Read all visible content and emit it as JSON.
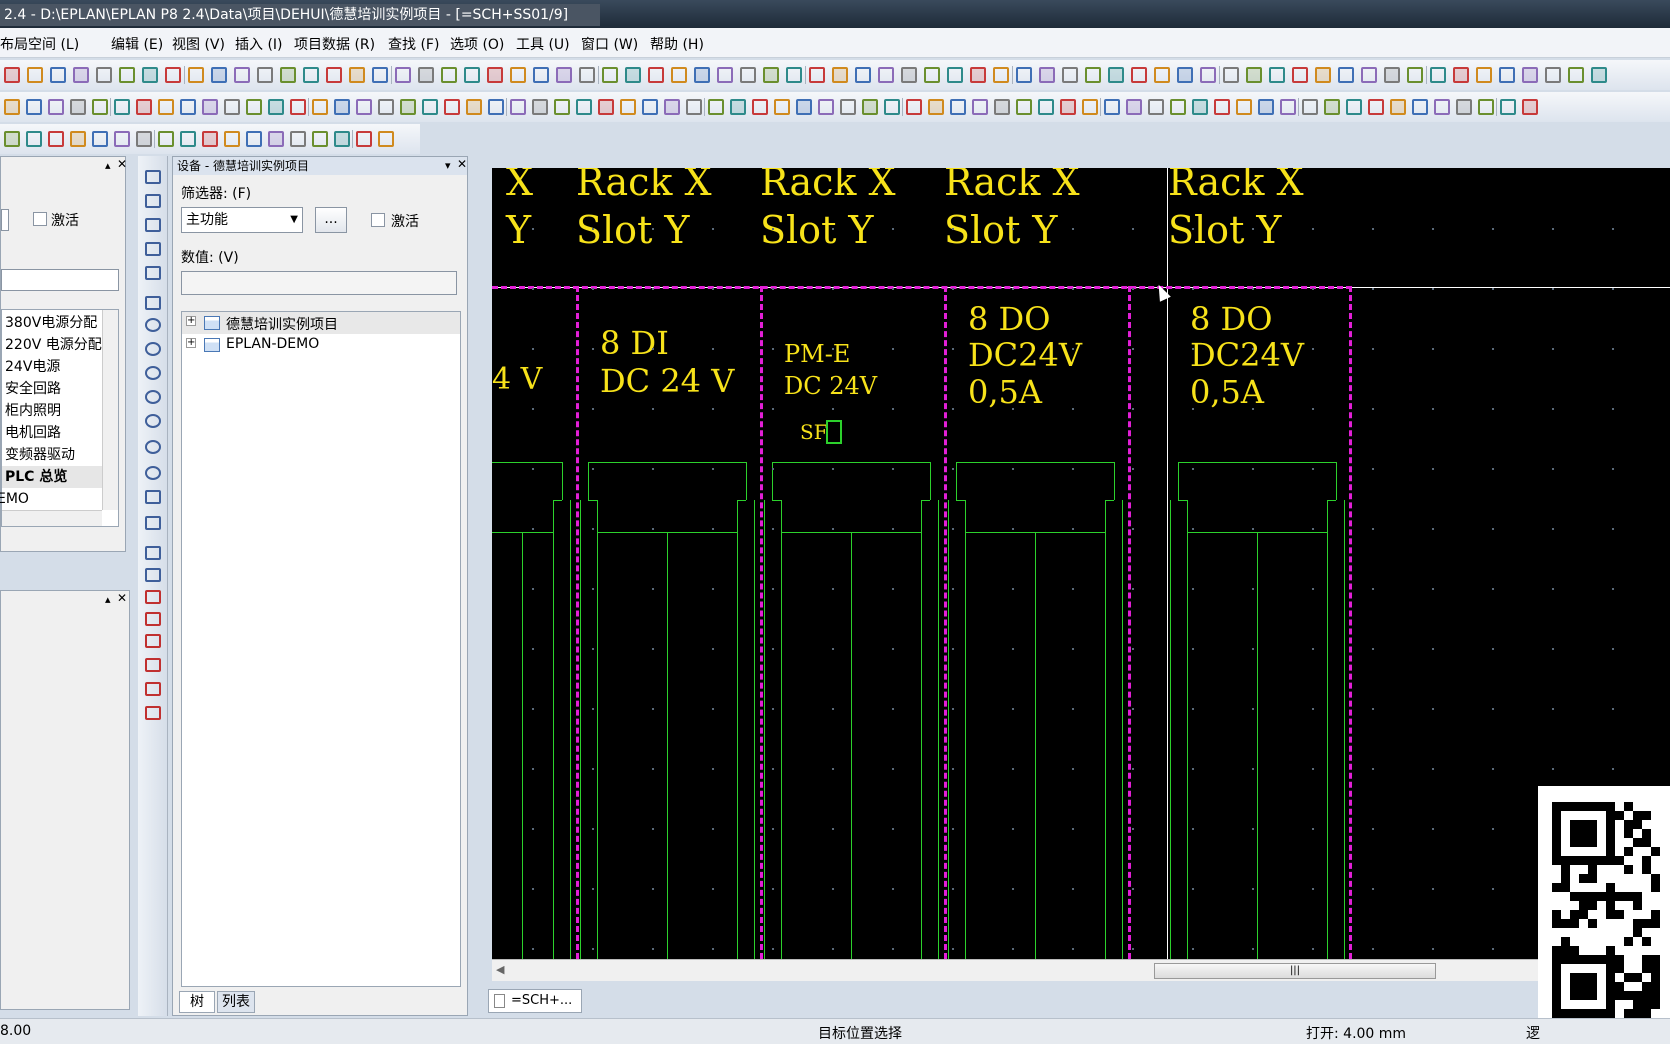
{
  "window": {
    "title": "2.4 - D:\\EPLAN\\EPLAN P8 2.4\\Data\\项目\\DEHUI\\德慧培训实例项目 - [=SCH+SS01/9]"
  },
  "menu": [
    "布局空间 (L)",
    "编辑 (E)",
    "视图 (V)",
    "插入 (I)",
    "项目数据 (R)",
    "查找 (F)",
    "选项 (O)",
    "工具 (U)",
    "窗口 (W)",
    "帮助 (H)"
  ],
  "left_panel": {
    "activate_label": "激活",
    "pages": [
      "380V电源分配",
      "220V 电源分配",
      "24V电源",
      "安全回路",
      "柜内照明",
      "电机回路",
      "变频器驱动",
      "PLC 总览",
      "EMO"
    ]
  },
  "device_panel": {
    "title": "设备 - 德慧培训实例项目",
    "filter_label": "筛选器: (F)",
    "filter_value": "主功能",
    "more_button": "...",
    "activate_label": "激活",
    "value_label": "数值: (V)",
    "value_input": "",
    "tree": [
      "德慧培训实例项目",
      "EPLAN-DEMO"
    ],
    "tabs": [
      "树",
      "列表"
    ]
  },
  "drawing": {
    "rack_labels": [
      "X",
      "Rack X",
      "Rack X",
      "Rack X",
      "Rack X"
    ],
    "slot_labels": [
      "Y",
      "Slot Y",
      "Slot Y",
      "Slot Y",
      "Slot Y"
    ],
    "module_texts": [
      {
        "lines": [
          "4 V"
        ]
      },
      {
        "lines": [
          "8 DI",
          "DC 24 V"
        ]
      },
      {
        "lines": [
          "PM-E",
          "DC 24V"
        ],
        "extra": "SF"
      },
      {
        "lines": [
          "8 DO",
          "DC24V",
          "0,5A"
        ]
      },
      {
        "lines": [
          "8 DO",
          "DC24V",
          "0,5A"
        ]
      }
    ],
    "tab_label": "=SCH+..."
  },
  "statusbar": {
    "coord": "8.00",
    "hint": "目标位置选择",
    "grid": "打开: 4.00 mm",
    "right": "逻"
  },
  "colors": {
    "drawing_bg": "#000000",
    "text": "#f7e21a",
    "boundary": "#e21fd6",
    "lines": "#2cd12c"
  }
}
